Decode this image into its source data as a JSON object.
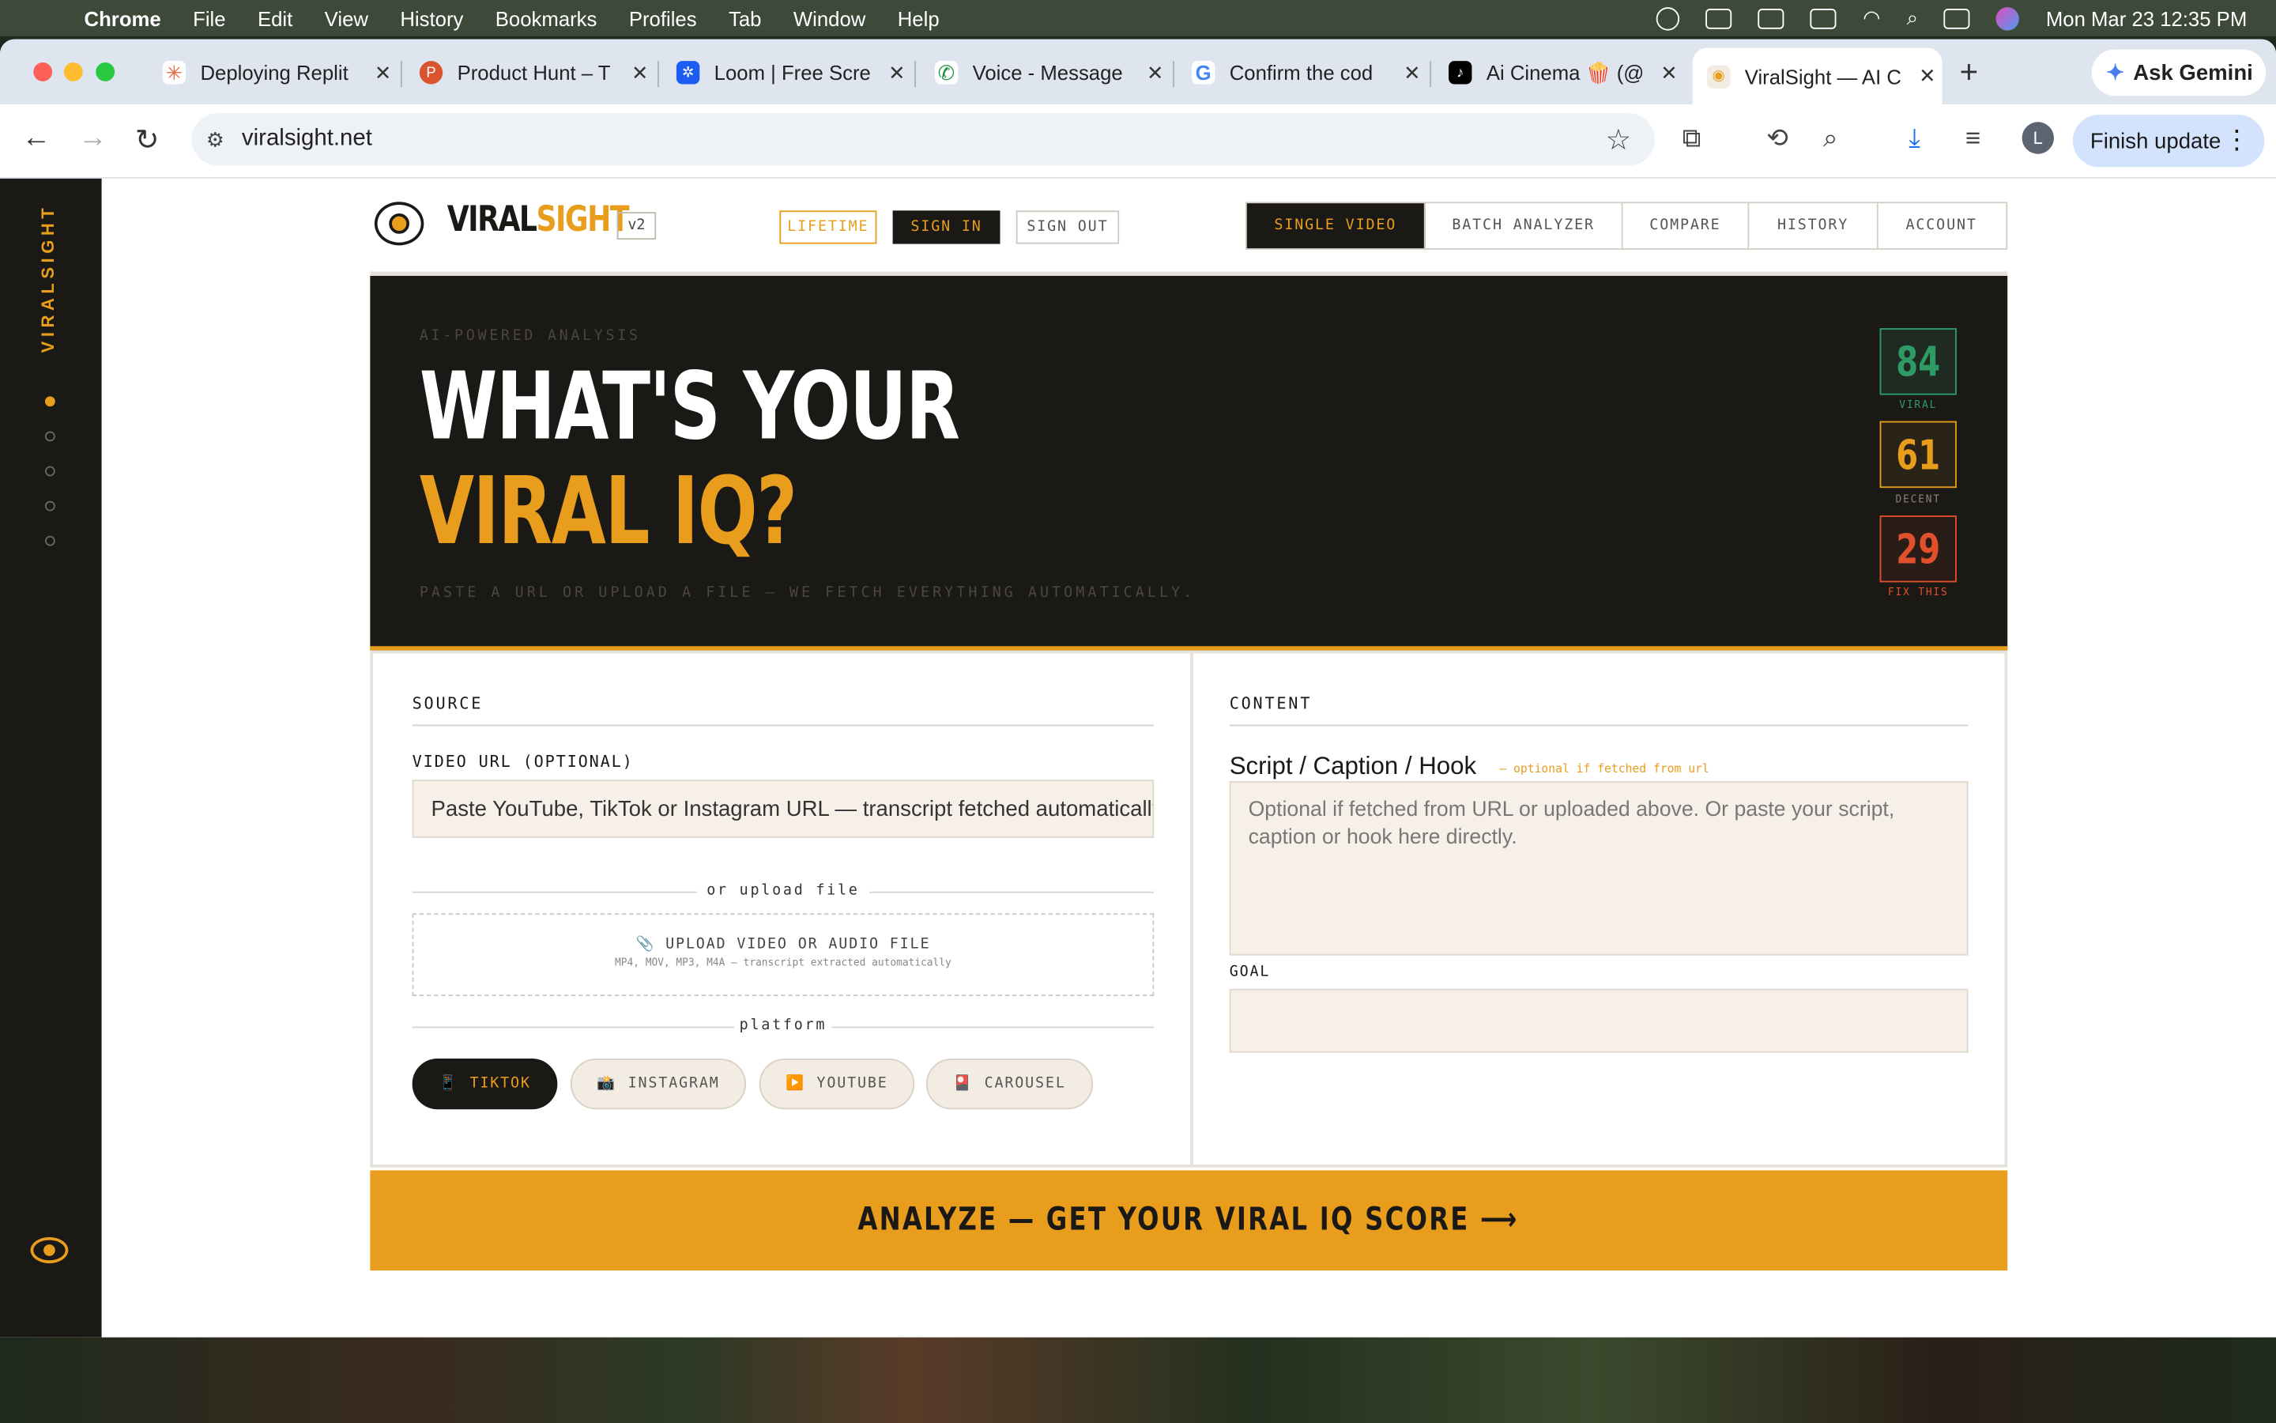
{
  "menubar": {
    "app": "Chrome",
    "items": [
      "File",
      "Edit",
      "View",
      "History",
      "Bookmarks",
      "Profiles",
      "Tab",
      "Window",
      "Help"
    ],
    "datetime": "Mon Mar 23  12:35 PM"
  },
  "tabs": [
    {
      "title": "Deploying Replit",
      "fav_color": "#e8643c",
      "fav_glyph": "✳"
    },
    {
      "title": "Product Hunt – T",
      "fav_color": "#da552f",
      "fav_glyph": "P"
    },
    {
      "title": "Loom | Free Scre",
      "fav_color": "#1d5cf0",
      "fav_glyph": "✲"
    },
    {
      "title": "Voice - Message",
      "fav_color": "#1e8e3e",
      "fav_glyph": "✆"
    },
    {
      "title": "Confirm the cod",
      "fav_color": "#ffffff",
      "fav_glyph": "G"
    },
    {
      "title": "Ai Cinema 🍿 (@",
      "fav_color": "#000000",
      "fav_glyph": "♪"
    },
    {
      "title": "ViralSight — AI C",
      "fav_color": "#f3ece3",
      "fav_glyph": "◉"
    }
  ],
  "gemini_label": "Ask Gemini",
  "url": "viralsight.net",
  "finish_update": "Finish update",
  "avatar_initial": "L",
  "rail": {
    "brand": "VIRALSIGHT"
  },
  "header": {
    "logo_a": "VIRAL",
    "logo_b": "SIGHT",
    "version": "v2",
    "lifetime": "LIFETIME",
    "sign_in": "SIGN IN",
    "sign_out": "SIGN OUT",
    "nav": [
      "SINGLE VIDEO",
      "BATCH ANALYZER",
      "COMPARE",
      "HISTORY",
      "ACCOUNT"
    ]
  },
  "hero": {
    "eyebrow": "AI-POWERED ANALYSIS",
    "line1": "WHAT'S YOUR",
    "line2": "VIRAL IQ?",
    "sub": "PASTE A URL OR UPLOAD A FILE — WE FETCH EVERYTHING AUTOMATICALLY.",
    "scores": [
      {
        "value": "84",
        "label": "VIRAL",
        "color": "#2e9b64"
      },
      {
        "value": "61",
        "label": "DECENT",
        "color": "#e89d1c"
      },
      {
        "value": "29",
        "label": "FIX THIS",
        "color": "#e0502a"
      }
    ]
  },
  "source": {
    "title": "SOURCE",
    "url_label": "VIDEO URL (OPTIONAL)",
    "url_placeholder": "Paste YouTube, TikTok or Instagram URL — transcript fetched automatically",
    "or_upload": "or upload file",
    "upload_title": "UPLOAD VIDEO OR AUDIO FILE",
    "upload_hint": "MP4, MOV, MP3, M4A — transcript extracted automatically",
    "platform_label": "platform",
    "platforms": [
      {
        "label": "TIKTOK",
        "icon": "📱"
      },
      {
        "label": "INSTAGRAM",
        "icon": "📸"
      },
      {
        "label": "YOUTUBE",
        "icon": "▶️"
      },
      {
        "label": "CAROUSEL",
        "icon": "🎴"
      }
    ]
  },
  "content": {
    "title": "CONTENT",
    "script_label": "Script / Caption / Hook",
    "script_note": "— optional if fetched from url",
    "script_placeholder": "Optional if fetched from URL or uploaded above. Or paste your script, caption or hook here directly.",
    "goal_label": "GOAL"
  },
  "cta": "ANALYZE — GET YOUR VIRAL IQ SCORE  ⟶",
  "colors": {
    "accent": "#e89d1c",
    "dark": "#1b1916",
    "field": "#f6f0e8"
  }
}
